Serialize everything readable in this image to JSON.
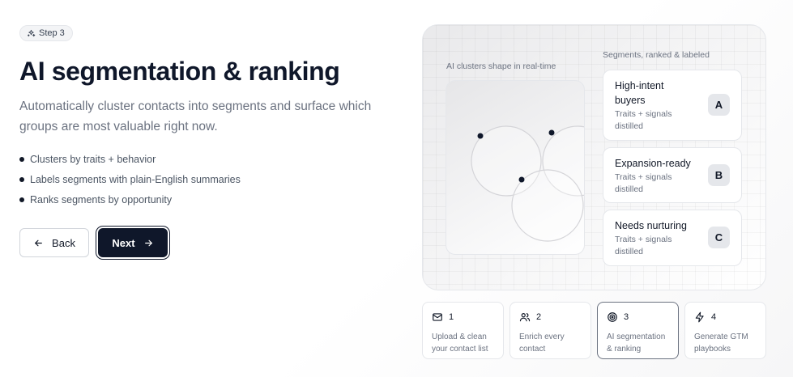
{
  "step_pill": {
    "label": "Step 3",
    "icon": "sparkles-icon"
  },
  "title": "AI segmentation & ranking",
  "subtitle": "Automatically cluster contacts into segments and surface which groups are most valuable right now.",
  "bullets": [
    "Clusters by traits + behavior",
    "Labels segments with plain-English summaries",
    "Ranks segments by opportunity"
  ],
  "buttons": {
    "back": "Back",
    "next": "Next"
  },
  "panel": {
    "clusters_label": "AI clusters shape in real-time",
    "segments_label": "Segments, ranked & labeled",
    "segments": [
      {
        "name_line1": "High-intent",
        "name_line2": "buyers",
        "desc_line1": "Traits + signals",
        "desc_line2": "distilled",
        "badge": "A"
      },
      {
        "name_line1": "Expansion-ready",
        "name_line2": "",
        "desc_line1": "Traits + signals",
        "desc_line2": "distilled",
        "badge": "B"
      },
      {
        "name_line1": "Needs nurturing",
        "name_line2": "",
        "desc_line1": "Traits + signals",
        "desc_line2": "distilled",
        "badge": "C"
      }
    ]
  },
  "steps": [
    {
      "number": "1",
      "line1": "Upload & clean",
      "line2": "your contact list",
      "icon": "mail-icon",
      "active": false
    },
    {
      "number": "2",
      "line1": "Enrich every",
      "line2": "contact",
      "icon": "users-icon",
      "active": false
    },
    {
      "number": "3",
      "line1": "AI segmentation",
      "line2": "& ranking",
      "icon": "target-icon",
      "active": true
    },
    {
      "number": "4",
      "line1": "Generate GTM",
      "line2": "playbooks",
      "icon": "zap-icon",
      "active": false
    }
  ],
  "colors": {
    "primary": "#0f172a",
    "muted": "#6b7280",
    "border": "#e5e7eb"
  }
}
